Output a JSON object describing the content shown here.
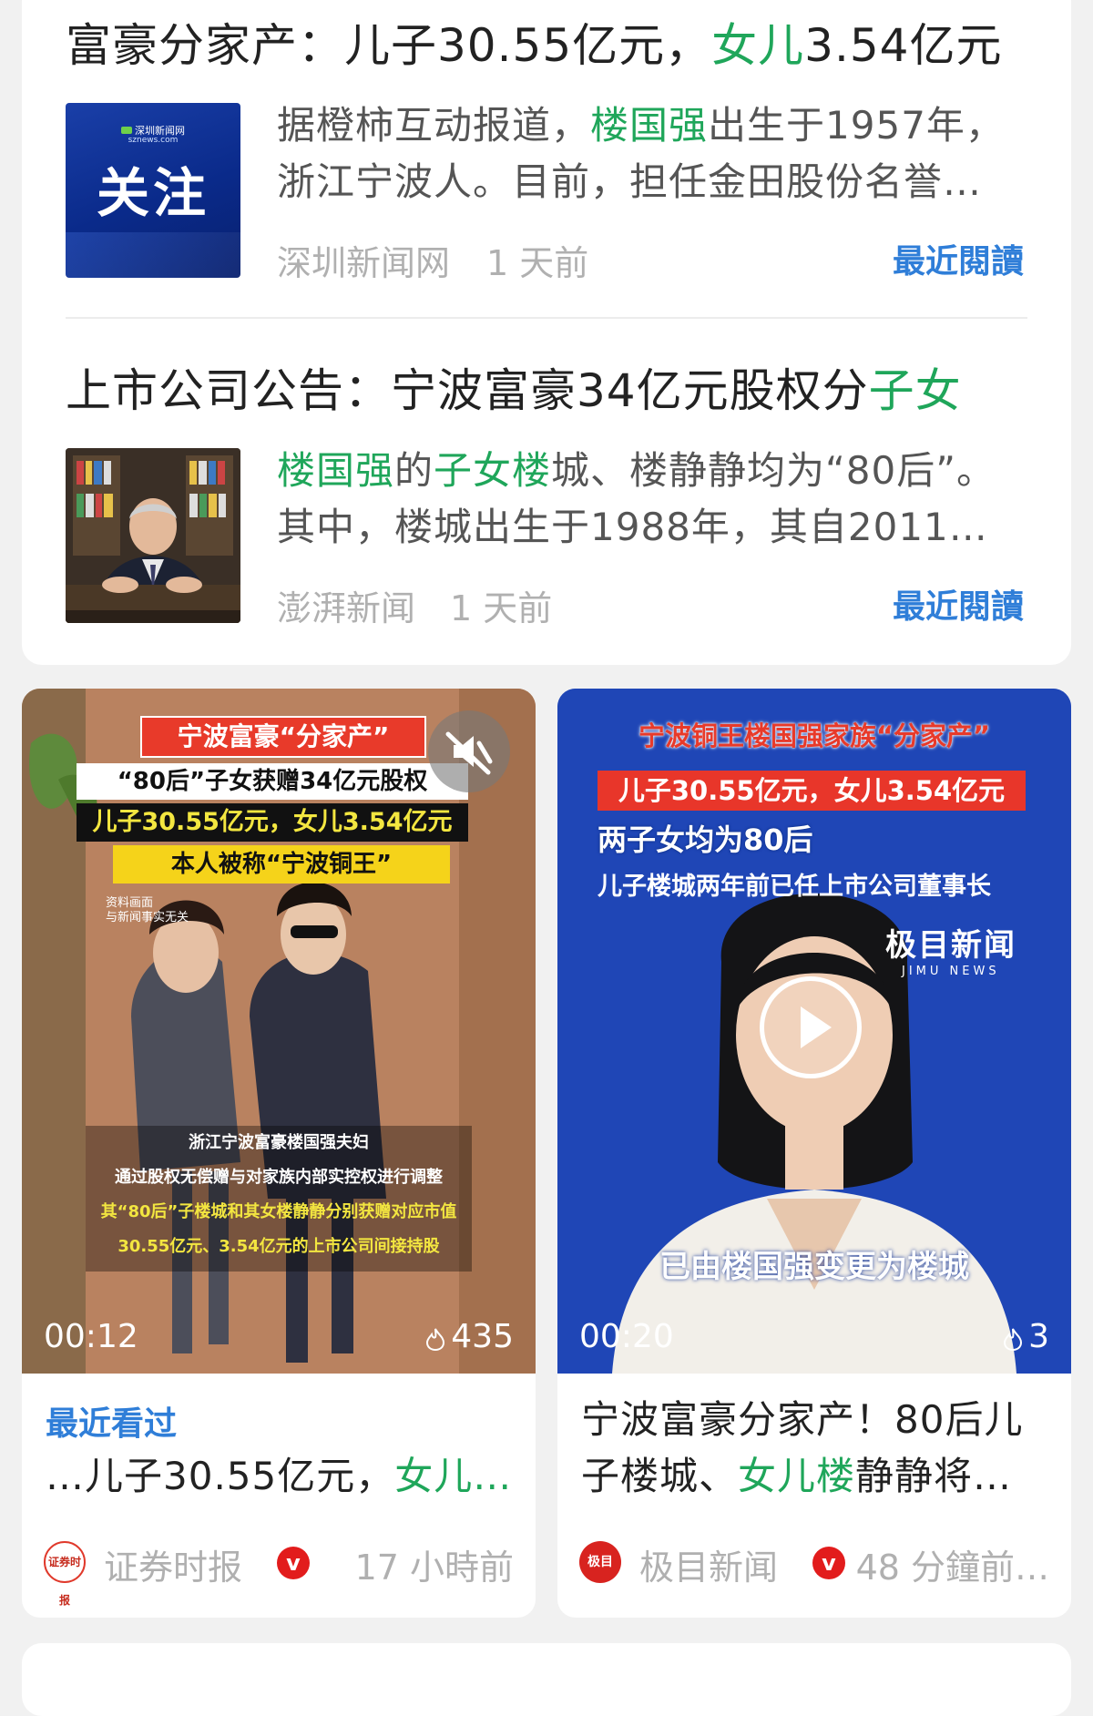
{
  "news": [
    {
      "title_prefix": "富豪分家产：儿子30.55亿元，",
      "title_highlight": "女儿",
      "title_suffix": "3.54亿元",
      "thumb_brand": "深圳新闻网",
      "thumb_brand_sub": "sznews.com",
      "thumb_word": "关注",
      "snippet_line1_a": "据橙柿互动报道，",
      "snippet_line1_hl": "楼国强",
      "snippet_line1_b": "出生于1957年，",
      "snippet_line2": "浙江宁波人。目前，担任金田股份名誉…",
      "source": "深圳新闻网",
      "time": "1 天前",
      "recent_label": "最近閱讀"
    },
    {
      "title_prefix": "上市公司公告：宁波富豪34亿元股权分",
      "title_highlight": "子女",
      "snippet_line1_hl1": "楼国强",
      "snippet_line1_a": "的",
      "snippet_line1_hl2": "子女楼",
      "snippet_line1_b": "城、楼静静均为“80后”。",
      "snippet_line2": "其中，楼城出生于1988年，其自2011年…",
      "source": "澎湃新闻",
      "time": "1 天前",
      "recent_label": "最近閱讀"
    }
  ],
  "videos": [
    {
      "banner_title": "宁波富豪“分家产”",
      "banner_line2": "“80后”子女获赠34亿元股权",
      "banner_line3": "儿子30.55亿元，女儿3.54亿元",
      "banner_line4": "本人被称“宁波铜王”",
      "disclaimer_1": "资料画面",
      "disclaimer_2": "与新闻事实无关",
      "sub_1": "浙江宁波富豪楼国强夫妇",
      "sub_2": "通过股权无偿赠与对家族内部实控权进行调整",
      "sub_3": "其“80后”子楼城和其女楼静静分别获赠对应市值",
      "sub_4": "30.55亿元、3.54亿元的上市公司间接持股",
      "duration": "00:12",
      "heat": "435",
      "recent_label": "最近看过",
      "caption_a": "…儿子30.55亿元，",
      "caption_hl": "女儿…",
      "source": "证券时报",
      "source_logo": "证券时报",
      "time": "17 小時前"
    },
    {
      "banner_title": "宁波铜王楼国强家族“分家产”",
      "banner_line2": "儿子30.55亿元，女儿3.54亿元",
      "banner_line3": "两子女均为80后",
      "banner_line4": "儿子楼城两年前已任上市公司董事长",
      "brand": "极目新闻",
      "brand_sub": "JIMU NEWS",
      "subtitle": "已由楼国强变更为楼城",
      "duration": "00:20",
      "heat": "3",
      "caption_line1": "宁波富豪分家产！80后儿",
      "caption_line2_a": "子楼城、",
      "caption_line2_hl": "女儿楼",
      "caption_line2_b": "静静将…",
      "source": "极目新闻",
      "source_logo": "极目",
      "time": "48 分鐘前…"
    }
  ],
  "colors": {
    "highlight": "#1fa65a",
    "recent": "#2f7ed8",
    "verified": "#e21c1c"
  }
}
